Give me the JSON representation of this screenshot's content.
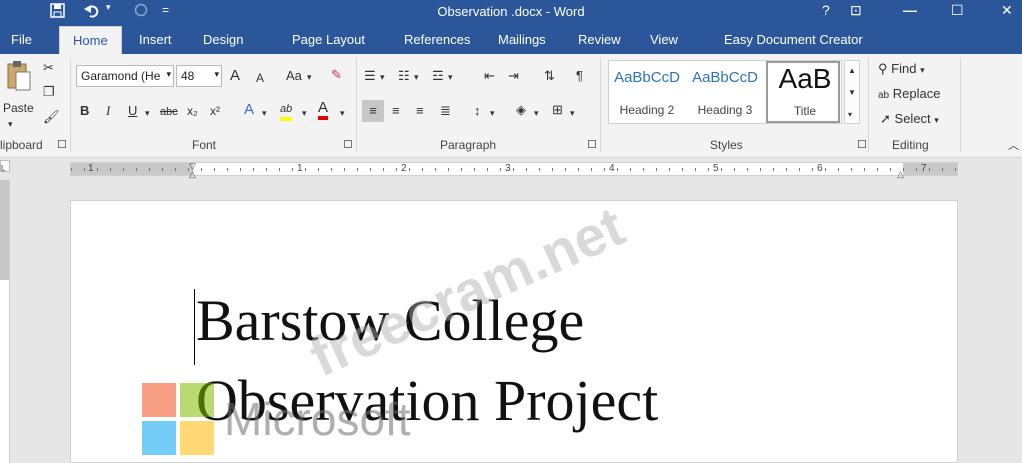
{
  "titlebar": {
    "title": "Observation .docx - Word",
    "help": "?",
    "restore_ribbon": "⊡",
    "minimize": "—",
    "maximize": "☐",
    "close": "✕",
    "save_icon": "save-icon",
    "undo_icon": "undo-icon",
    "redo_icon": "redo-icon",
    "customize": "="
  },
  "tabs": [
    "File",
    "Home",
    "Insert",
    "Design",
    "Page Layout",
    "References",
    "Mailings",
    "Review",
    "View",
    "Easy Document Creator"
  ],
  "active_tab": "Home",
  "clipboard": {
    "paste_label": "Paste",
    "group_label": "lipboard"
  },
  "font": {
    "family": "Garamond (He",
    "size": "48",
    "grow": "A",
    "shrink": "A",
    "case": "Aa",
    "bold": "B",
    "italic": "I",
    "underline": "U",
    "strike": "abc",
    "subscript": "x₂",
    "superscript": "x²",
    "effects": "A",
    "highlight": "ab",
    "color": "A",
    "group_label": "Font",
    "highlight_color": "#ffff00",
    "font_color": "#e00000"
  },
  "paragraph": {
    "group_label": "Paragraph",
    "show_marks": "¶"
  },
  "styles": {
    "group_label": "Styles",
    "items": [
      {
        "sample": "AaBbCcD",
        "name": "Heading 2"
      },
      {
        "sample": "AaBbCcD",
        "name": "Heading 3"
      },
      {
        "sample": "AaB",
        "name": "Title"
      }
    ]
  },
  "editing": {
    "find": "Find",
    "replace": "Replace",
    "select": "Select",
    "group_label": "Editing"
  },
  "ruler": {
    "numbers": [
      "1",
      "1",
      "2",
      "3",
      "4",
      "5",
      "6",
      "7"
    ]
  },
  "document": {
    "line1": "Barstow College",
    "line2": "Observation Project"
  },
  "watermark": {
    "site": "freecram.net",
    "brand": "Microsoft"
  },
  "colors": {
    "word_blue": "#2b579a",
    "ms_red": "#f25022",
    "ms_green": "#7fba00",
    "ms_blue": "#00a4ef",
    "ms_yellow": "#ffb900"
  }
}
